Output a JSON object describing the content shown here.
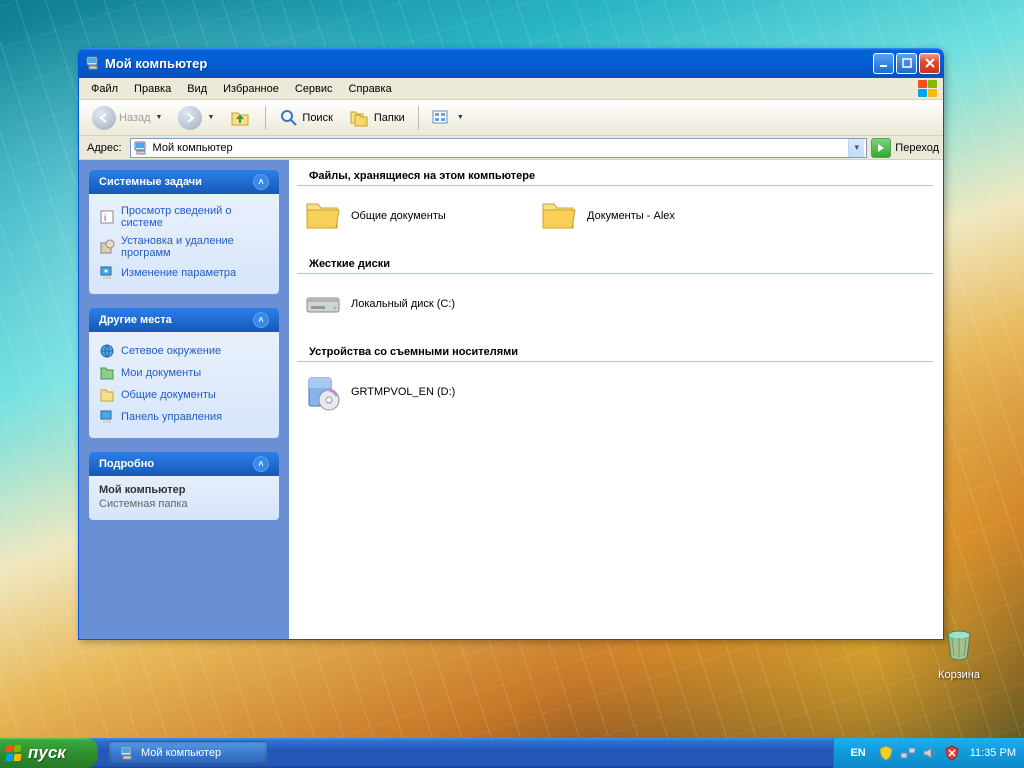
{
  "desktop": {
    "recycle_bin_label": "Корзина"
  },
  "window": {
    "title": "Мой компьютер",
    "menu": [
      "Файл",
      "Правка",
      "Вид",
      "Избранное",
      "Сервис",
      "Справка"
    ],
    "toolbar": {
      "back": "Назад",
      "search": "Поиск",
      "folders": "Папки"
    },
    "address": {
      "label": "Адрес:",
      "value": "Мой компьютер",
      "go": "Переход"
    },
    "side": {
      "system_tasks": {
        "title": "Системные задачи",
        "items": [
          "Просмотр сведений о системе",
          "Установка и удаление программ",
          "Изменение параметра"
        ]
      },
      "other_places": {
        "title": "Другие места",
        "items": [
          "Сетевое окружение",
          "Мои документы",
          "Общие документы",
          "Панель управления"
        ]
      },
      "details": {
        "title": "Подробно",
        "name": "Мой компьютер",
        "type": "Системная папка"
      }
    },
    "groups": [
      {
        "header": "Файлы, хранящиеся на этом компьютере",
        "items": [
          {
            "kind": "folder",
            "label": "Общие документы"
          },
          {
            "kind": "folder",
            "label": "Документы - Alex"
          }
        ]
      },
      {
        "header": "Жесткие диски",
        "items": [
          {
            "kind": "hdd",
            "label": "Локальный диск (C:)"
          }
        ]
      },
      {
        "header": "Устройства со съемными носителями",
        "items": [
          {
            "kind": "cd",
            "label": "GRTMPVOL_EN (D:)"
          }
        ]
      }
    ]
  },
  "taskbar": {
    "start": "пуск",
    "task_item": "Мой компьютер",
    "language": "EN",
    "clock": "11:35 PM"
  }
}
